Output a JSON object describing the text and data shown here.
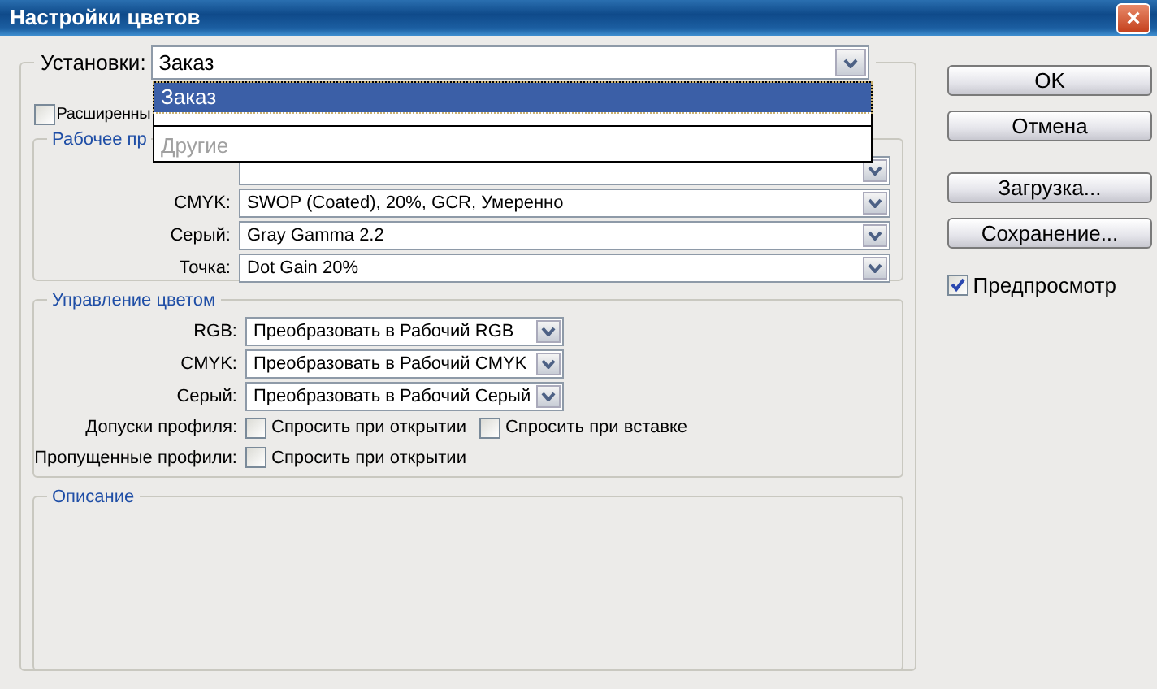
{
  "window": {
    "title": "Настройки цветов",
    "close": "×"
  },
  "settings": {
    "label": "Установки:",
    "value": "Заказ",
    "dropdown": [
      {
        "kind": "item",
        "label": "Заказ",
        "selected": true,
        "disabled": false
      },
      {
        "kind": "separator"
      },
      {
        "kind": "item",
        "label": "Другие",
        "selected": false,
        "disabled": true
      }
    ]
  },
  "advanced": {
    "label": "Расширенны",
    "checked": false
  },
  "working_spaces": {
    "title": "Рабочее пр",
    "rows": [
      {},
      {
        "label": "CMYK:",
        "value": "SWOP (Coated), 20%, GCR, Умеренно"
      },
      {
        "label": "Серый:",
        "value": "Gray Gamma 2.2"
      },
      {
        "label": "Точка:",
        "value": "Dot Gain 20%"
      }
    ]
  },
  "color_management": {
    "title": "Управление цветом",
    "rows": [
      {
        "kind": "select",
        "label": "RGB:",
        "value": "Преобразовать в Рабочий RGB"
      },
      {
        "kind": "select",
        "label": "CMYK:",
        "value": "Преобразовать в Рабочий CMYK"
      },
      {
        "kind": "select",
        "label": "Серый:",
        "value": "Преобразовать в Рабочий Серый"
      },
      {
        "kind": "checks",
        "label": "Допуски профиля:",
        "checks": [
          {
            "label": "Спросить при открытии",
            "checked": false
          },
          {
            "label": "Спросить при вставке",
            "checked": false
          }
        ]
      },
      {
        "kind": "checks",
        "label": "Пропущенные профили:",
        "checks": [
          {
            "label": "Спросить при открытии",
            "checked": false
          }
        ]
      }
    ]
  },
  "description": {
    "title": "Описание"
  },
  "buttons": [
    {
      "label": "OK"
    },
    {
      "label": "Отмена"
    },
    {
      "label": "Загрузка..."
    },
    {
      "label": "Сохранение..."
    }
  ],
  "preview": {
    "label": "Предпросмотр",
    "checked": true
  }
}
